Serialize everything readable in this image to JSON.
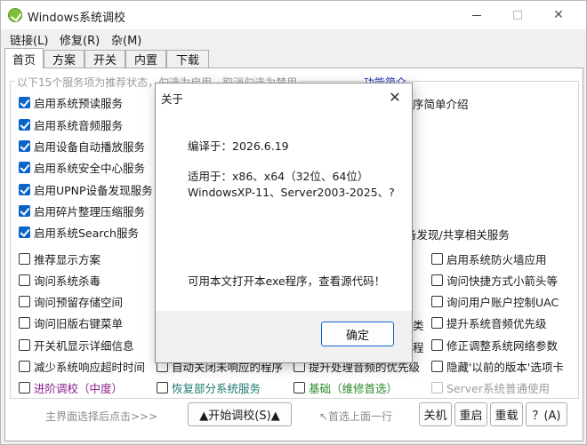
{
  "window": {
    "title": "Windows系统调校"
  },
  "menu": [
    "链接(L)",
    "修复(R)",
    "杂(M)"
  ],
  "tabs": [
    "首页",
    "方案",
    "开关",
    "内置",
    "下载"
  ],
  "group": {
    "caption": "以下15个服务项为推荐状态，勾选为启用，取消勾选为禁用",
    "link": "功能简介"
  },
  "left_checks": [
    {
      "label": "启用系统预读服务",
      "checked": true
    },
    {
      "label": "启用系统音频服务",
      "checked": true
    },
    {
      "label": "启用设备自动播放服务",
      "checked": true
    },
    {
      "label": "启用系统安全中心服务",
      "checked": true
    },
    {
      "label": "启用UPNP设备发现服务",
      "checked": true
    },
    {
      "label": "启用碎片整理压缩服务",
      "checked": true
    },
    {
      "label": "启用系统Search服务",
      "checked": true
    },
    {
      "label": "推荐显示方案",
      "checked": false
    },
    {
      "label": "询问系统杀毒",
      "checked": false
    },
    {
      "label": "询问预留存储空间",
      "checked": false
    },
    {
      "label": "询问旧版右键菜单",
      "checked": false
    },
    {
      "label": "开关机显示详细信息",
      "checked": false
    },
    {
      "label": "减少系统响应超时时间",
      "checked": false
    },
    {
      "label": "进阶调校（中度）",
      "checked": false
    }
  ],
  "right_partial": {
    "intro": "序简单介绍",
    "discovery": "备发现/共享相关服务",
    "cut1": "类",
    "cut2": "程"
  },
  "right_checks": [
    {
      "label": "启用系统防火墙应用",
      "checked": false
    },
    {
      "label": "询问快捷方式小箭头等",
      "checked": false
    },
    {
      "label": "询问用户账户控制UAC",
      "checked": false
    },
    {
      "label": "提升系统音频优先级",
      "checked": false
    },
    {
      "label": "修正调整系统网络参数",
      "checked": false
    },
    {
      "label": "隐藏'以前的版本'选项卡",
      "checked": false
    },
    {
      "label": "Server系统普通使用",
      "checked": false
    }
  ],
  "mid_checks": [
    {
      "label": "自动关闭未响应的程序",
      "checked": false
    },
    {
      "label": "提升处理音频的优先级",
      "checked": false
    },
    {
      "label": "恢复部分系统服务",
      "checked": false
    },
    {
      "label": "基础（维修首选）",
      "checked": false
    }
  ],
  "bottom": {
    "hint_left": "主界面选择后点击>>>",
    "start_button": "▲开始调校(S)▲",
    "hint_right": "↖首选上面一行",
    "shutdown": "关机",
    "restart": "重启",
    "reload": "重载",
    "help": "？(A)"
  },
  "dialog": {
    "title": "关于",
    "compile": "编译于：2026.6.19",
    "applies": "适用于：x86、x64（32位、64位）",
    "systems": "WindowsXP-11、Server2003-2025、?",
    "notepad": "可用本文打开本exe程序，查看源代码！",
    "ok": "确定"
  },
  "colors": {
    "checked": "#0a64c8",
    "link": "#1b2ea8",
    "advanced": "#8b1e8b",
    "restore": "#1f7a72",
    "basic": "#2a8a2a"
  }
}
